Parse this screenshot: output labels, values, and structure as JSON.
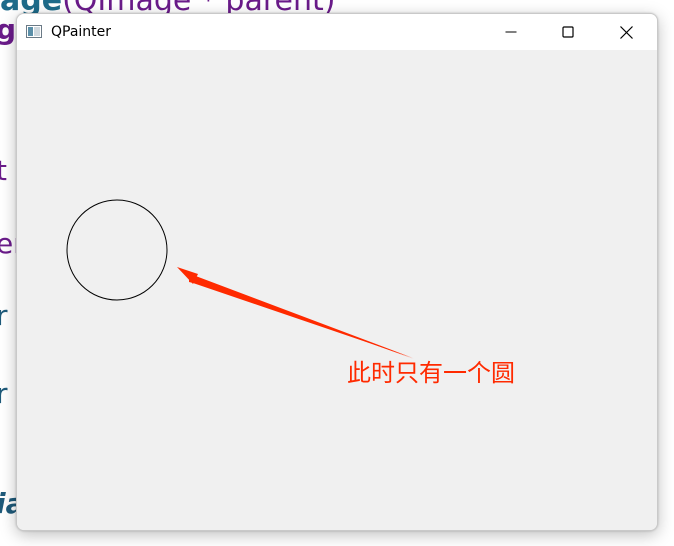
{
  "background": {
    "top_fragment_word": "age",
    "top_fragment_paren": "(QImage * parent)",
    "left_fragments": [
      "ge",
      "t :",
      "er",
      "r .",
      "r .",
      "ia"
    ]
  },
  "window": {
    "title": "QPainter",
    "controls": {
      "minimize": "—",
      "maximize": "☐",
      "close": "✕"
    }
  },
  "canvas": {
    "shape": "circle",
    "stroke_color": "#000000"
  },
  "annotation": {
    "text": "此时只有一个圆",
    "color": "#ff2a00"
  }
}
